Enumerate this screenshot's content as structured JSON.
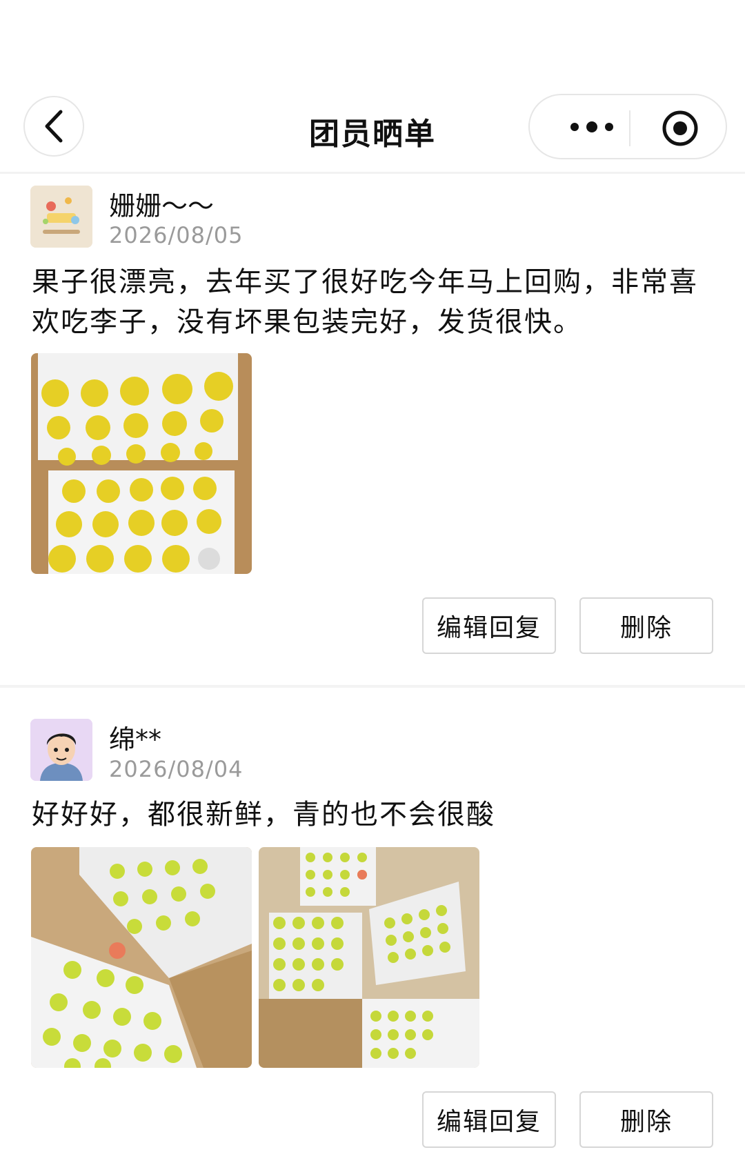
{
  "header": {
    "title": "团员晒单",
    "back_icon": "chevron-left-icon",
    "more_icon": "more-dots-icon",
    "close_icon": "target-circle-icon"
  },
  "reviews": [
    {
      "name": "姗姗～～",
      "date": "2026/08/05",
      "content": "果子很漂亮，去年买了很好吃今年马上回购，非常喜欢吃李子，没有坏果包装完好，发货很快。",
      "photos": [
        "plum-box-photo"
      ],
      "edit_label": "编辑回复",
      "delete_label": "删除"
    },
    {
      "name": "绵**",
      "date": "2026/08/04",
      "content": "好好好，都很新鲜，青的也不会很酸",
      "photos": [
        "green-plum-box-photo",
        "multiple-boxes-photo"
      ],
      "edit_label": "编辑回复",
      "delete_label": "删除"
    }
  ]
}
